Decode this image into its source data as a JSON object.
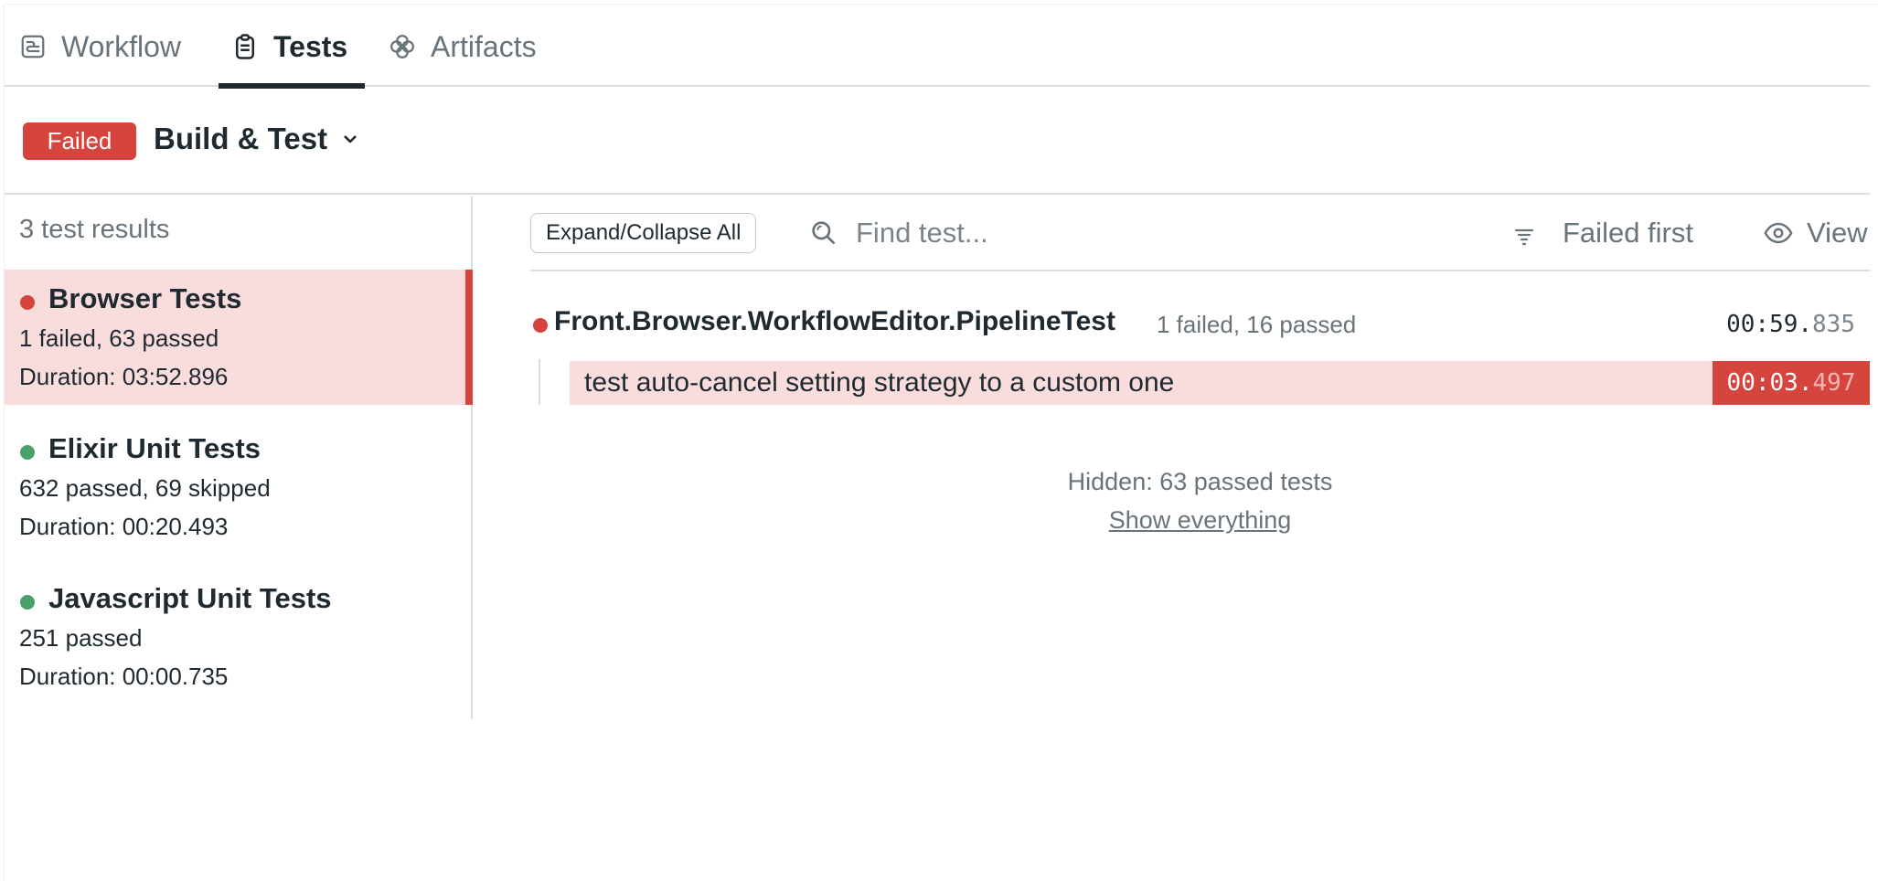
{
  "tabs": [
    {
      "label": "Workflow",
      "icon": "workflow-icon",
      "active": false
    },
    {
      "label": "Tests",
      "icon": "clipboard-icon",
      "active": true
    },
    {
      "label": "Artifacts",
      "icon": "artifacts-icon",
      "active": false
    }
  ],
  "header": {
    "status_badge": "Failed",
    "pipeline_name": "Build & Test"
  },
  "sidebar": {
    "results_count": "3 test results",
    "suites": [
      {
        "name": "Browser Tests",
        "summary": "1 failed, 63 passed",
        "duration": "Duration: 03:52.896",
        "status": "failed",
        "selected": true
      },
      {
        "name": "Elixir Unit Tests",
        "summary": "632 passed, 69 skipped",
        "duration": "Duration: 00:20.493",
        "status": "passed",
        "selected": false
      },
      {
        "name": "Javascript Unit Tests",
        "summary": "251 passed",
        "duration": "Duration: 00:00.735",
        "status": "passed",
        "selected": false
      }
    ]
  },
  "toolbar": {
    "expand_collapse_label": "Expand/Collapse All",
    "search_placeholder": "Find test...",
    "search_value": "",
    "sort_label": "Failed first",
    "view_label": "View"
  },
  "results": {
    "group": {
      "name": "Front.Browser.WorkflowEditor.PipelineTest",
      "stats": "1 failed, 16 passed",
      "time_main": "00:59.",
      "time_ms": "835",
      "status": "failed"
    },
    "tests": [
      {
        "name": "test auto-cancel setting strategy to a custom one",
        "time_main": "00:03.",
        "time_ms": "497",
        "status": "failed"
      }
    ],
    "hidden_info": "Hidden: 63 passed tests",
    "show_everything_label": "Show everything"
  },
  "colors": {
    "failed": "#d6453d",
    "failed_bg": "#f9dcdc",
    "passed": "#4a9f6a",
    "text_primary": "#1f2a30",
    "text_muted": "#69737a"
  }
}
